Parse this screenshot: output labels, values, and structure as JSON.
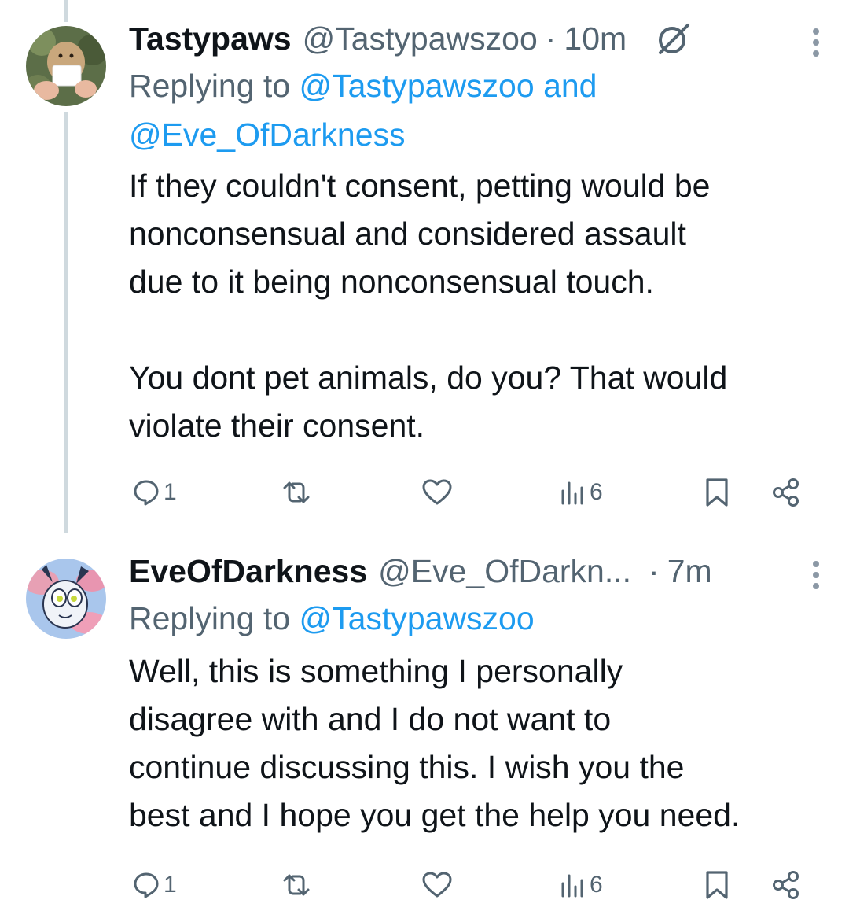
{
  "tweets": [
    {
      "name": "Tastypaws",
      "handle": "@Tastypawszoo",
      "separator": "·",
      "time": "10m",
      "replying_prefix": "Replying to",
      "replying_to_1": "@Tastypawszoo",
      "replying_and": "and",
      "replying_to_2": "@Eve_OfDarkness",
      "body": "If they couldn't consent, petting would be\nnonconsensual and considered assault\ndue to it being nonconsensual touch.\n\nYou dont pet animals, do you? That would\nviolate their consent.",
      "replies": "1",
      "views": "6",
      "icons": [
        "grok-icon",
        "more-icon",
        "reply-icon",
        "retweet-icon",
        "like-icon",
        "views-icon",
        "bookmark-icon",
        "share-icon"
      ]
    },
    {
      "name": "EveOfDarkness",
      "handle": "@Eve_OfDarkn...",
      "separator": "·",
      "time": "7m",
      "replying_prefix": "Replying to",
      "replying_to_1": "@Tastypawszoo",
      "body": "Well, this is something I personally\ndisagree with and I do not want to\ncontinue discussing this. I wish you the\nbest and I hope you get the help you need.",
      "replies": "1",
      "views": "6",
      "icons": [
        "more-icon",
        "reply-icon",
        "retweet-icon",
        "like-icon",
        "views-icon",
        "bookmark-icon",
        "share-icon"
      ]
    }
  ],
  "colors": {
    "link": "#1d9bf0",
    "secondary_text": "#536471",
    "primary_text": "#0f1419",
    "thread_line": "#cfd9de"
  }
}
